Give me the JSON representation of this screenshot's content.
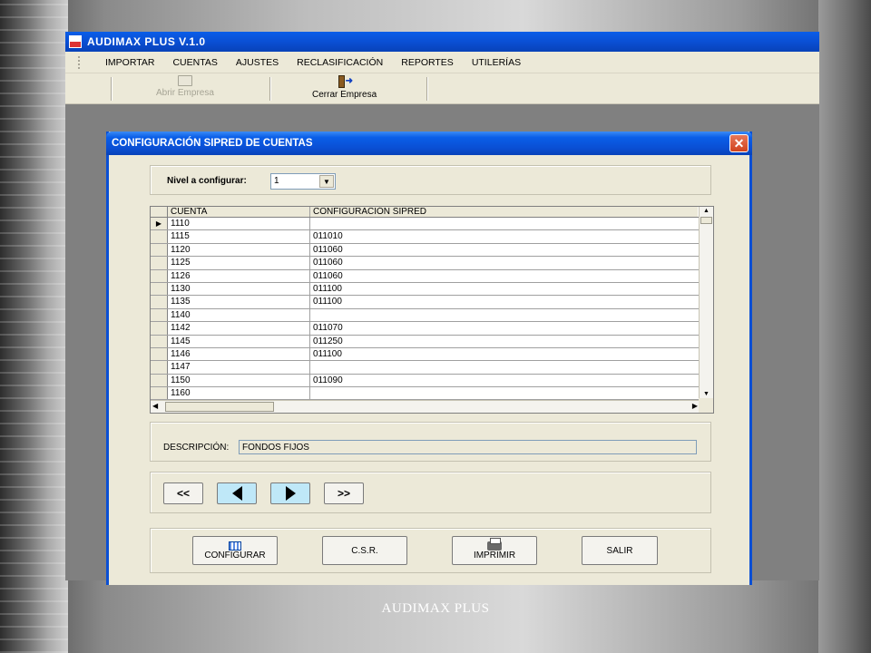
{
  "app": {
    "title": "AUDIMAX PLUS V.1.0",
    "menu": [
      "IMPORTAR",
      "CUENTAS",
      "AJUSTES",
      "RECLASIFICACIÓN",
      "REPORTES",
      "UTILERÍAS"
    ],
    "toolbar": {
      "abrir_label": "Abrir Empresa",
      "cerrar_label": "Cerrar Empresa"
    }
  },
  "dialog": {
    "title": "CONFIGURACIÓN SIPRED DE CUENTAS",
    "close_label": "✕",
    "nivel_label": "Nivel a configurar:",
    "nivel_value": "1",
    "grid": {
      "headers": [
        "CUENTA",
        "CONFIGURACIÓN SIPRED"
      ],
      "rows": [
        {
          "cuenta": "1110",
          "sipred": ""
        },
        {
          "cuenta": "1115",
          "sipred": "011010"
        },
        {
          "cuenta": "1120",
          "sipred": "011060"
        },
        {
          "cuenta": "1125",
          "sipred": "011060"
        },
        {
          "cuenta": "1126",
          "sipred": "011060"
        },
        {
          "cuenta": "1130",
          "sipred": "011100"
        },
        {
          "cuenta": "1135",
          "sipred": "011100"
        },
        {
          "cuenta": "1140",
          "sipred": ""
        },
        {
          "cuenta": "1142",
          "sipred": "011070"
        },
        {
          "cuenta": "1145",
          "sipred": "011250"
        },
        {
          "cuenta": "1146",
          "sipred": "011100"
        },
        {
          "cuenta": "1147",
          "sipred": ""
        },
        {
          "cuenta": "1150",
          "sipred": "011090"
        },
        {
          "cuenta": "1160",
          "sipred": ""
        }
      ]
    },
    "descripcion_label": "DESCRIPCIÓN:",
    "descripcion_value": "FONDOS FIJOS",
    "nav": {
      "first": "<<",
      "last": ">>"
    },
    "actions": {
      "configurar": "CONFIGURAR",
      "csr": "C.S.R.",
      "imprimir": "IMPRIMIR",
      "salir": "SALIR"
    }
  },
  "footer": "AUDIMAX PLUS"
}
